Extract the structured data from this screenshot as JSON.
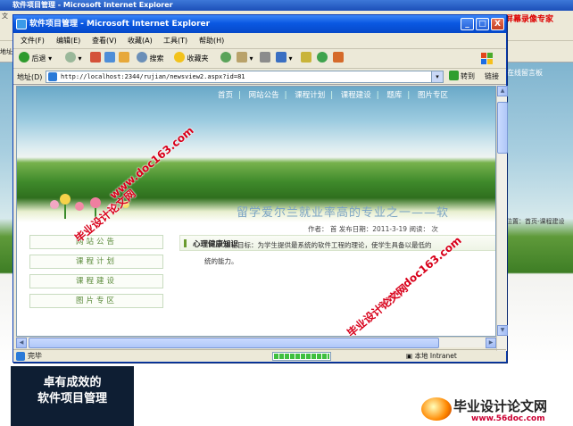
{
  "outer_window": {
    "title": "软件项目管理 - Microsoft Internet Explorer",
    "menu_fragment": "文",
    "address_fragment": "地址",
    "nav_fragment": "在线留言板",
    "breadcrumb": "位置：首页-课程建设"
  },
  "recorder_label": "屏幕录像专家",
  "ie_window": {
    "title": "软件项目管理 - Microsoft Internet Explorer",
    "controls": {
      "minimize": "_",
      "maximize": "□",
      "close": "X"
    },
    "menu": [
      "文件(F)",
      "编辑(E)",
      "查看(V)",
      "收藏(A)",
      "工具(T)",
      "帮助(H)"
    ],
    "toolbar": {
      "back": "后退",
      "search": "搜索",
      "favorites": "收藏夹"
    },
    "address_label": "地址(D)",
    "address_value": "http://localhost:2344/rujian/newsview2.aspx?id=81",
    "go_label": "转到",
    "links_label": "链接",
    "status_text": "完毕",
    "zone_text": "本地 Intranet"
  },
  "page": {
    "top_nav": [
      "首页",
      "网站公告",
      "课程计划",
      "课程建设",
      "题库",
      "图片专区"
    ],
    "side_menu": [
      "网站公告",
      "课程计划",
      "课程建设",
      "图片专区"
    ],
    "section_title": "心理健康知识",
    "article_title": "留学爱尔兰就业率高的专业之一——软",
    "article_meta": "作者：       首  发布日期：2011-3-19 阅读：  次",
    "article_body_1": "课程目标：为学生提供最系统的软件工程的理论，使学生具备以最低的",
    "article_body_2": "统的能力。"
  },
  "promo": {
    "line1": "卓有成效的",
    "line2": "软件项目管理"
  },
  "ad_brand": {
    "title": "毕业设计论文网",
    "url": "www.56doc.com"
  },
  "watermarks": [
    "www.doc163.com",
    "毕业设计论文网"
  ],
  "colors": {
    "xp_title": "#0a58e2",
    "nav_green": "#5a8a3a",
    "watermark_red": "#d8001a"
  }
}
